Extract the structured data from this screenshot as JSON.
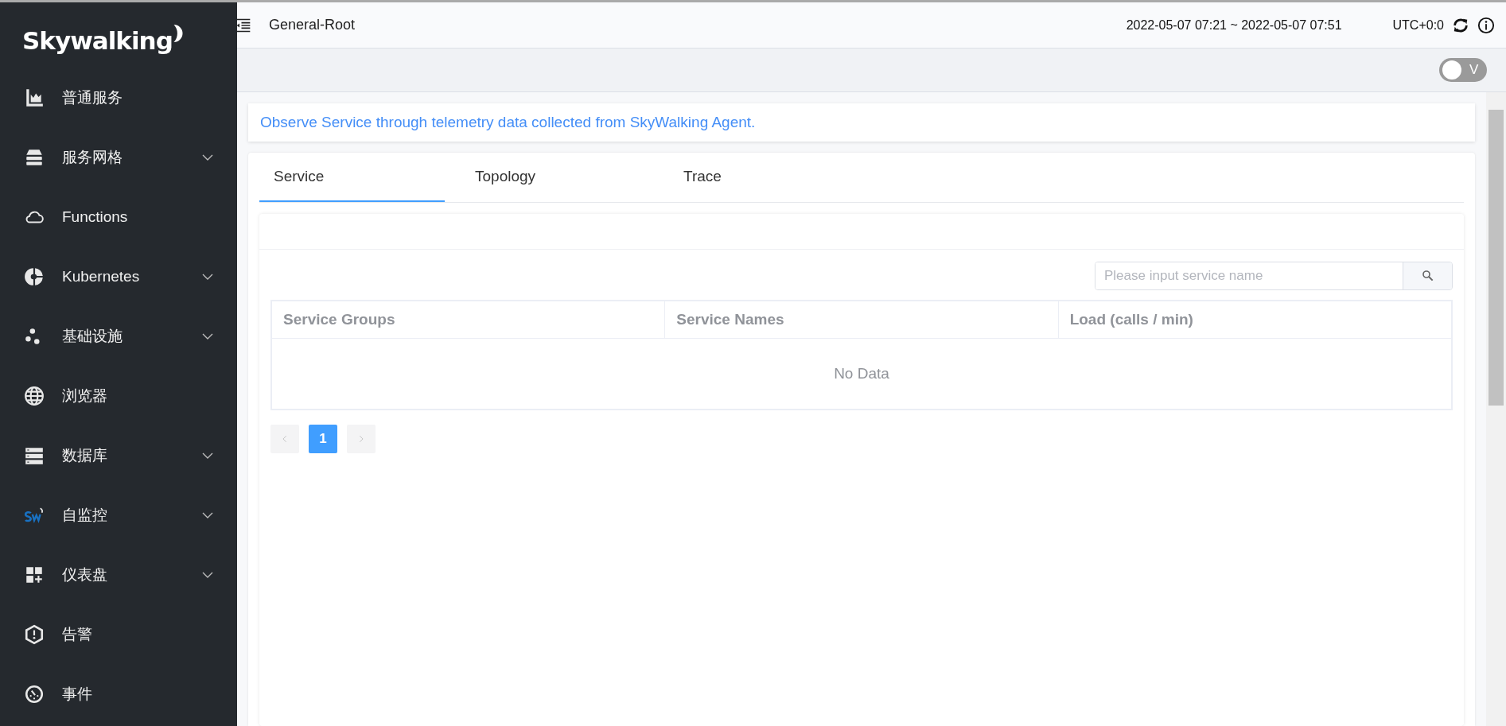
{
  "sidebar": {
    "logo": "Skywalking",
    "items": [
      {
        "label": "普通服务",
        "expandable": false
      },
      {
        "label": "服务网格",
        "expandable": true
      },
      {
        "label": "Functions",
        "expandable": false
      },
      {
        "label": "Kubernetes",
        "expandable": true
      },
      {
        "label": "基础设施",
        "expandable": true
      },
      {
        "label": "浏览器",
        "expandable": false
      },
      {
        "label": "数据库",
        "expandable": true
      },
      {
        "label": "自监控",
        "expandable": true
      },
      {
        "label": "仪表盘",
        "expandable": true
      },
      {
        "label": "告警",
        "expandable": false
      },
      {
        "label": "事件",
        "expandable": false
      }
    ]
  },
  "header": {
    "title": "General-Root",
    "time_range": "2022-05-07 07:21 ~ 2022-05-07 07:51",
    "timezone": "UTC+0:0"
  },
  "toolbar": {
    "toggle": {
      "label": "V",
      "on": false
    }
  },
  "description": "Observe Service through telemetry data collected from SkyWalking Agent.",
  "tabs": [
    {
      "label": "Service",
      "selected": true
    },
    {
      "label": "Topology",
      "selected": false
    },
    {
      "label": "Trace",
      "selected": false
    }
  ],
  "search": {
    "placeholder": "Please input service name"
  },
  "table": {
    "columns": [
      "Service Groups",
      "Service Names",
      "Load (calls / min)"
    ],
    "empty_text": "No Data"
  },
  "pagination": {
    "pages": [
      {
        "label": "1",
        "selected": true
      }
    ]
  }
}
